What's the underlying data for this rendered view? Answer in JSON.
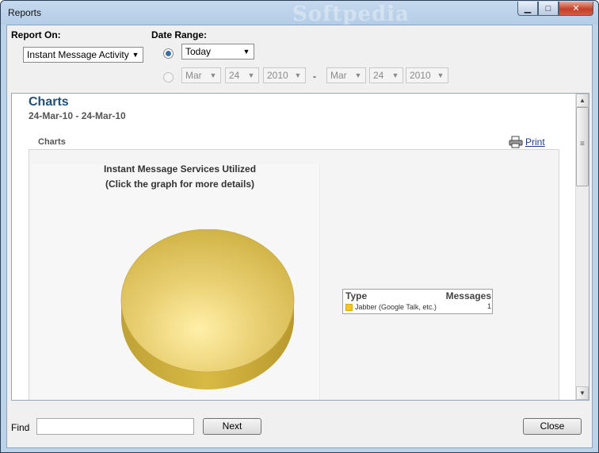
{
  "window": {
    "title": "Reports",
    "watermark": "Softpedia",
    "buttons": {
      "minimize": "▁",
      "maximize": "□",
      "close": "✕"
    }
  },
  "controls": {
    "report_on_label": "Report On:",
    "report_on_value": "Instant Message Activity",
    "date_range_label": "Date Range:",
    "preset_value": "Today",
    "from": {
      "month": "Mar",
      "day": "24",
      "year": "2010"
    },
    "separator": "-",
    "to": {
      "month": "Mar",
      "day": "24",
      "year": "2010"
    }
  },
  "report": {
    "title": "Charts",
    "range": "24-Mar-10 - 24-Mar-10",
    "section_label": "Charts",
    "print_label": "Print",
    "chart_title_line1": "Instant Message Services Utilized",
    "chart_title_line2": "(Click the graph for more details)"
  },
  "chart_data": {
    "type": "pie",
    "categories": [
      "Jabber (Google Talk, etc.)"
    ],
    "values": [
      1
    ],
    "colors": [
      "#e8c84a"
    ],
    "legend_headers": [
      "Type",
      "Messages"
    ],
    "title": "Instant Message Services Utilized"
  },
  "footer": {
    "find_label": "Find",
    "find_value": "",
    "next_label": "Next",
    "close_label": "Close"
  },
  "colors": {
    "accent": "#1f4e78",
    "link": "#1f3c8c",
    "window_frame": "#bcd3ea"
  }
}
